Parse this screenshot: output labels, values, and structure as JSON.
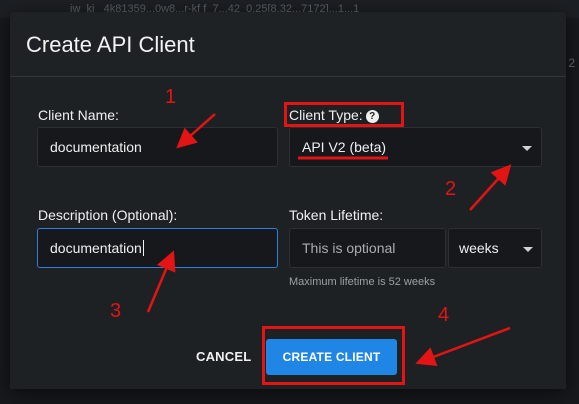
{
  "background": {
    "strip_text": "iw_ki_ 4k81359...0w8...r-kf f_7...42_0.25[8.32...7172]...1...1",
    "side_text": "2"
  },
  "dialog": {
    "title": "Create API Client",
    "client_name": {
      "label": "Client Name:",
      "value": "documentation"
    },
    "client_type": {
      "label": "Client Type:",
      "help_icon": "?",
      "selected": "API V2 (beta)"
    },
    "description": {
      "label": "Description (Optional):",
      "value": "documentation"
    },
    "token_lifetime": {
      "label": "Token Lifetime:",
      "placeholder": "This is optional",
      "unit": "weeks",
      "hint": "Maximum lifetime is 52 weeks"
    },
    "cancel_label": "CANCEL",
    "create_label": "CREATE CLIENT"
  },
  "annotations": {
    "n1": "1",
    "n2": "2",
    "n3": "3",
    "n4": "4"
  },
  "colors": {
    "accent": "#1f86e6",
    "annotation": "#e31414",
    "focus_border": "#2f7fe0"
  }
}
